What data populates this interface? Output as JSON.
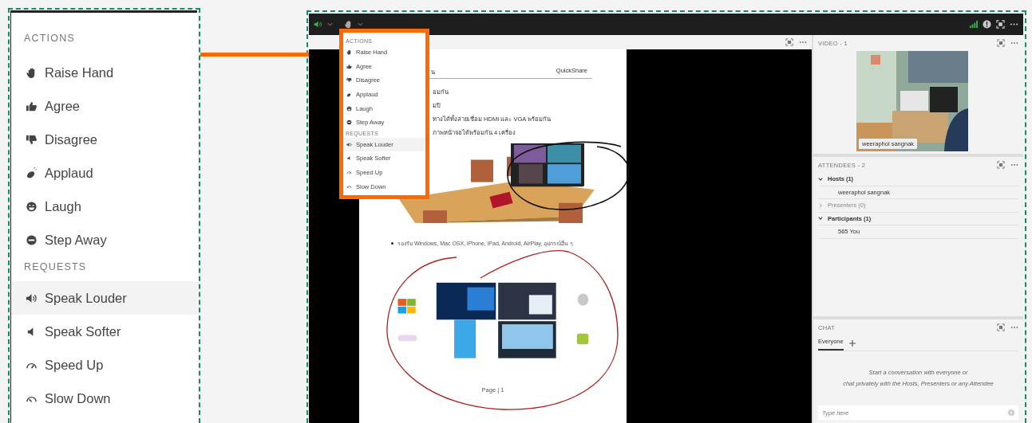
{
  "zoomed_menu": {
    "sections": [
      {
        "title": "ACTIONS",
        "items": [
          {
            "label": "Raise Hand",
            "selected": false
          },
          {
            "label": "Agree",
            "selected": false
          },
          {
            "label": "Disagree",
            "selected": false
          },
          {
            "label": "Applaud",
            "selected": false
          },
          {
            "label": "Laugh",
            "selected": false
          },
          {
            "label": "Step Away",
            "selected": false
          }
        ]
      },
      {
        "title": "REQUESTS",
        "items": [
          {
            "label": "Speak Louder",
            "selected": true
          },
          {
            "label": "Speak Softer",
            "selected": false
          },
          {
            "label": "Speed Up",
            "selected": false
          },
          {
            "label": "Slow Down",
            "selected": false
          }
        ]
      }
    ]
  },
  "app": {
    "reactions_menu": {
      "sections": [
        {
          "title": "ACTIONS",
          "items": [
            {
              "label": "Raise Hand",
              "selected": false
            },
            {
              "label": "Agree",
              "selected": false
            },
            {
              "label": "Disagree",
              "selected": false
            },
            {
              "label": "Applaud",
              "selected": false
            },
            {
              "label": "Laugh",
              "selected": false
            },
            {
              "label": "Step Away",
              "selected": false
            }
          ]
        },
        {
          "title": "REQUESTS",
          "items": [
            {
              "label": "Speak Louder",
              "selected": true
            },
            {
              "label": "Speak Softer",
              "selected": false
            },
            {
              "label": "Speed Up",
              "selected": false
            },
            {
              "label": "Slow Down",
              "selected": false
            }
          ]
        }
      ]
    },
    "share_pod": {
      "page": {
        "header_left": "น",
        "header_right": "QuickShare",
        "lines": [
          "อมกัน",
          "มปิ",
          "ทางได้ทั้งสายเชื่อม HDMI และ VGA พร้อมกัน",
          "ภาพหน้าจอได้พร้อมกัน 4 เครื่อง"
        ],
        "bullet": "รองรับ Windows, Mac OSX, iPhone, iPad, Android, AirPlay, อุปกรณ์อื่น ๆ",
        "footer": "Page | 1"
      }
    },
    "video_pod": {
      "title": "VIDEO - 1",
      "name_tag": "weeraphol sangnak"
    },
    "attendees": {
      "title": "ATTENDEES - 2",
      "groups": [
        {
          "label": "Hosts (1)",
          "expanded": true,
          "children": [
            {
              "label": "weeraphol sangnak"
            }
          ]
        },
        {
          "label": "Presenters (0)",
          "expanded": false
        },
        {
          "label": "Participants (1)",
          "expanded": true,
          "children": [
            {
              "label": "565  You"
            }
          ]
        }
      ]
    },
    "chat": {
      "title": "CHAT",
      "tabs": [
        {
          "label": "Everyone",
          "selected": true
        }
      ],
      "message": [
        "Start a conversation with everyone or",
        "chat privately with the Hosts, Presenters or any Attendee"
      ],
      "input": {
        "placeholder": "Type here"
      }
    }
  }
}
